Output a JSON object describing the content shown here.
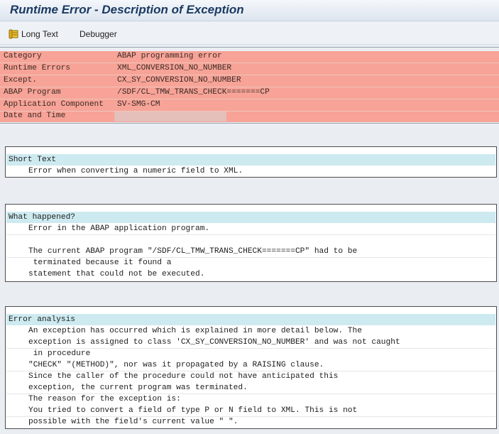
{
  "window": {
    "title": "Runtime Error - Description of Exception"
  },
  "toolbar": {
    "long_text_label": "Long Text",
    "debugger_label": "Debugger"
  },
  "header": {
    "rows": [
      {
        "label": "Category",
        "value": "ABAP programming error"
      },
      {
        "label": "Runtime Errors",
        "value": "XML_CONVERSION_NO_NUMBER"
      },
      {
        "label": "Except.",
        "value": "CX_SY_CONVERSION_NO_NUMBER"
      },
      {
        "label": "ABAP Program",
        "value": "/SDF/CL_TMW_TRANS_CHECK=======CP"
      },
      {
        "label": "Application Component",
        "value": "SV-SMG-CM"
      },
      {
        "label": "Date and Time",
        "value": ""
      }
    ]
  },
  "short_text": {
    "heading": "Short Text",
    "lines": [
      "Error when converting a numeric field to XML."
    ]
  },
  "what_happened": {
    "heading": "What happened?",
    "lines": [
      "Error in the ABAP application program.",
      "",
      "The current ABAP program \"/SDF/CL_TMW_TRANS_CHECK=======CP\" had to be",
      " terminated because it found a",
      "statement that could not be executed."
    ]
  },
  "error_analysis": {
    "heading": "Error analysis",
    "lines": [
      "An exception has occurred which is explained in more detail below. The",
      "exception is assigned to class 'CX_SY_CONVERSION_NO_NUMBER' and was not caught",
      " in procedure",
      "\"CHECK\" \"(METHOD)\", nor was it propagated by a RAISING clause.",
      "Since the caller of the procedure could not have anticipated this",
      "exception, the current program was terminated.",
      "The reason for the exception is:",
      "You tried to convert a field of type P or N field to XML. This is not",
      "possible with the field's current value \" \"."
    ]
  }
}
